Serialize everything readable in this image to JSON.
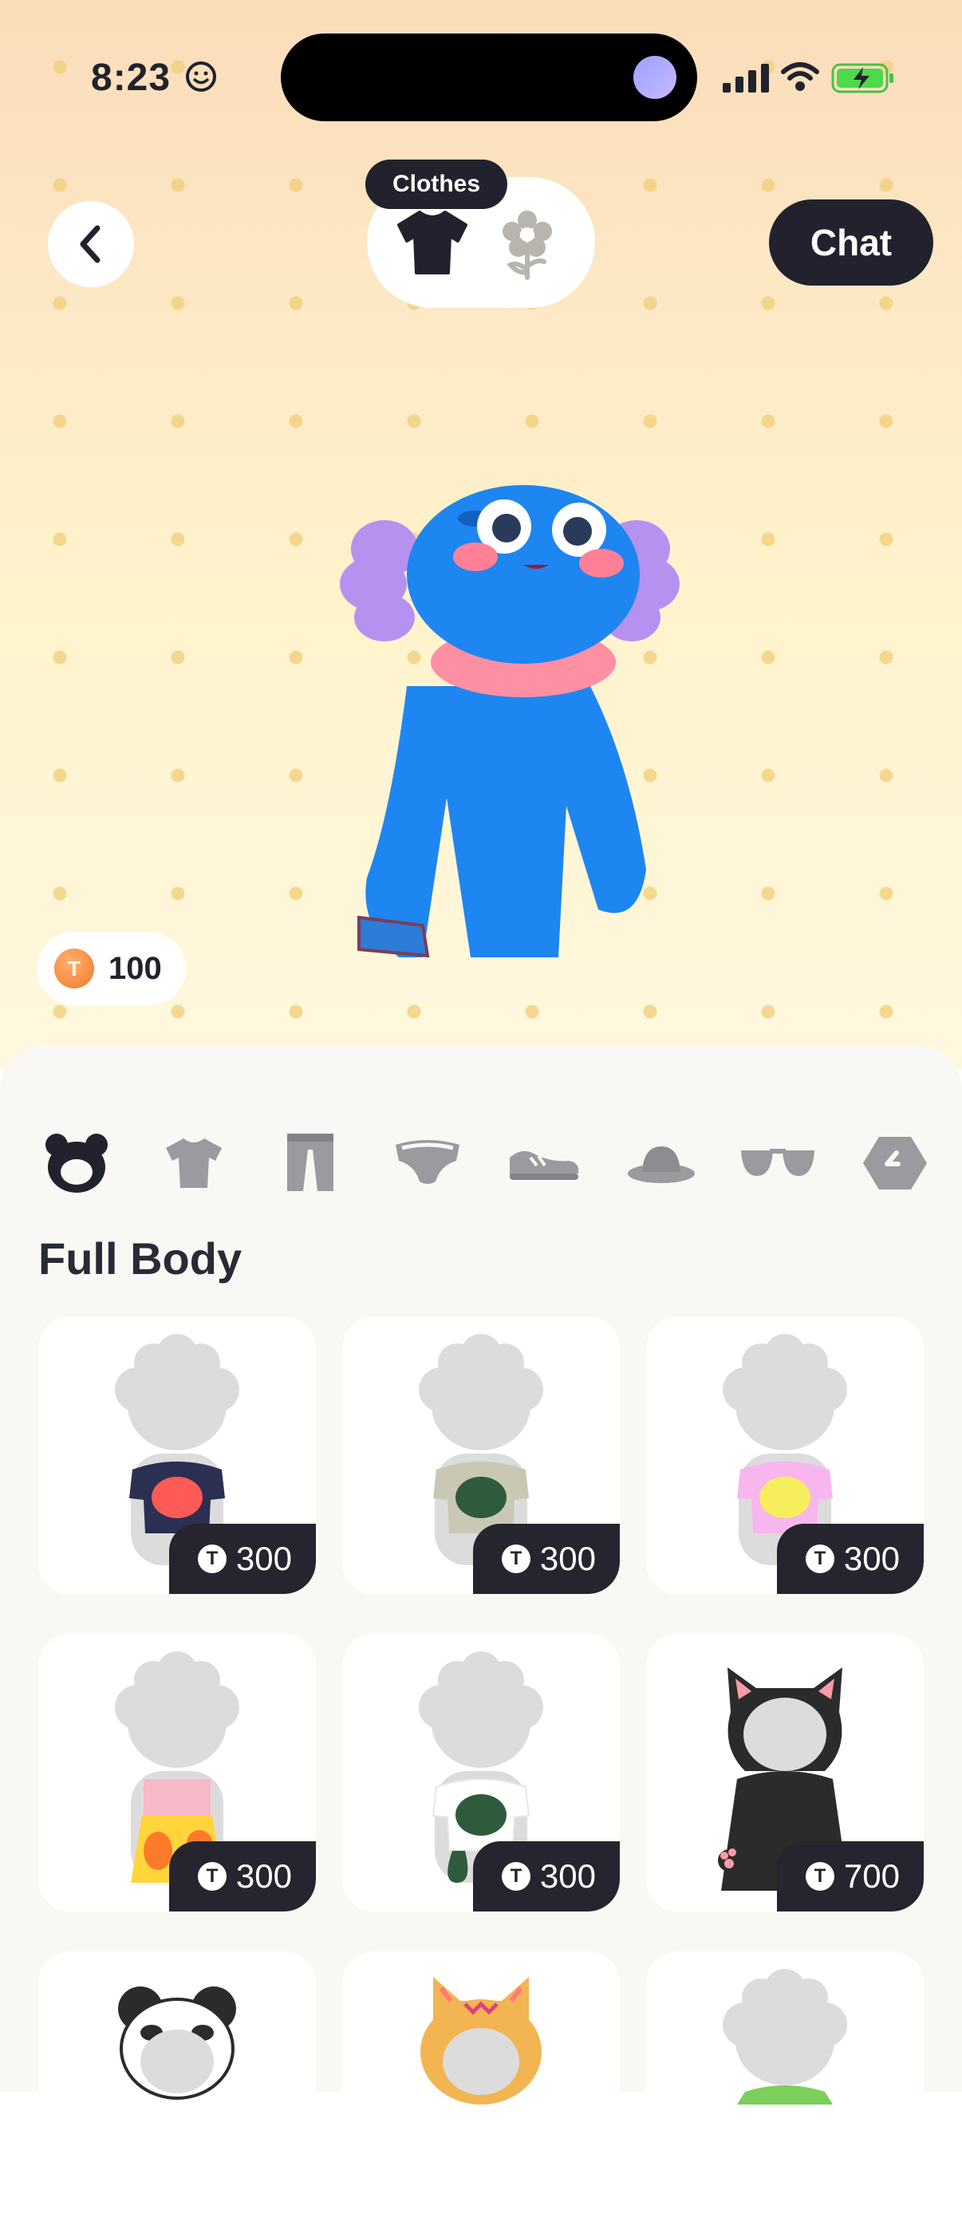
{
  "status_bar": {
    "time": "8:23"
  },
  "header": {
    "tooltip": "Clothes",
    "chat_label": "Chat",
    "tabs": [
      {
        "icon": "shirt-icon",
        "active": true
      },
      {
        "icon": "flower-icon",
        "active": false
      }
    ]
  },
  "wallet": {
    "coins": "100",
    "coin_glyph": "T"
  },
  "categories": [
    "bear-icon",
    "tshirt-icon",
    "pants-icon",
    "headband-icon",
    "shoe-icon",
    "hat-icon",
    "sunglasses-icon",
    "tag-icon"
  ],
  "section": {
    "title": "Full Body"
  },
  "items": [
    {
      "price": "300",
      "shirt_color": "#2b2f52",
      "pattern_color": "#ff5a55",
      "kind": "tee"
    },
    {
      "price": "300",
      "shirt_color": "#c9c8b5",
      "pattern_color": "#2f5b3d",
      "kind": "tee"
    },
    {
      "price": "300",
      "shirt_color": "#f8b6ee",
      "pattern_color": "#f6ee5c",
      "kind": "tee"
    },
    {
      "price": "300",
      "shirt_color": "#f7b8c8",
      "pattern_color": "#ffd53a",
      "kind": "dress"
    },
    {
      "price": "300",
      "shirt_color": "#ffffff",
      "pattern_color": "#2f5b3d",
      "kind": "tee"
    },
    {
      "price": "700",
      "shirt_color": "#2b2b2b",
      "pattern_color": "#ff9aa8",
      "kind": "cat"
    }
  ],
  "colors": {
    "accent": "#22222e",
    "avatar_body": "#1e86f0",
    "scarf": "#ff8fa3"
  }
}
